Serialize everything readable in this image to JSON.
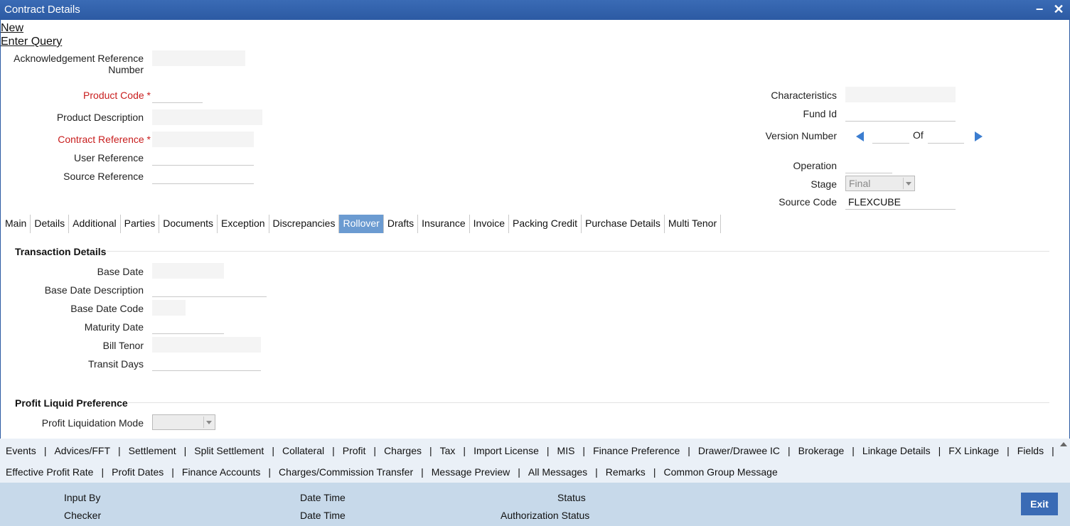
{
  "window": {
    "title": "Contract Details"
  },
  "actions": {
    "new": "New",
    "enter_query": "Enter Query"
  },
  "header": {
    "ack_ref_label_1": "Acknowledgement Reference",
    "ack_ref_label_2": "Number",
    "product_code_label": "Product Code",
    "required_mark": "*",
    "product_description_label": "Product Description",
    "contract_reference_label": "Contract Reference",
    "user_reference_label": "User Reference",
    "source_reference_label": "Source Reference",
    "characteristics_label": "Characteristics",
    "fund_id_label": "Fund Id",
    "version_number_label": "Version Number",
    "version_of": "Of",
    "operation_label": "Operation",
    "stage_label": "Stage",
    "stage_value": "Final",
    "source_code_label": "Source Code",
    "source_code_value": "FLEXCUBE"
  },
  "tabs": [
    {
      "label": "Main"
    },
    {
      "label": "Details"
    },
    {
      "label": "Additional"
    },
    {
      "label": "Parties"
    },
    {
      "label": "Documents"
    },
    {
      "label": "Exception"
    },
    {
      "label": "Discrepancies"
    },
    {
      "label": "Rollover"
    },
    {
      "label": "Drafts"
    },
    {
      "label": "Insurance"
    },
    {
      "label": "Invoice"
    },
    {
      "label": "Packing Credit"
    },
    {
      "label": "Purchase Details"
    },
    {
      "label": "Multi Tenor"
    }
  ],
  "active_tab": "Rollover",
  "transaction": {
    "title": "Transaction Details",
    "base_date": "Base Date",
    "base_date_description": "Base Date Description",
    "base_date_code": "Base Date Code",
    "maturity_date": "Maturity Date",
    "bill_tenor": "Bill Tenor",
    "transit_days": "Transit Days"
  },
  "profit": {
    "title": "Profit Liquid Preference",
    "mode_label": "Profit Liquidation Mode"
  },
  "bottom_links_row1": [
    "Events",
    "Advices/FFT",
    "Settlement",
    "Split Settlement",
    "Collateral",
    "Profit",
    "Charges",
    "Tax",
    "Import License",
    "MIS",
    "Finance Preference",
    "Drawer/Drawee IC",
    "Brokerage",
    "Linkage Details",
    "FX Linkage",
    "Fields"
  ],
  "bottom_links_row2": [
    "Effective Profit Rate",
    "Profit Dates",
    "Finance Accounts",
    "Charges/Commission Transfer",
    "Message Preview",
    "All Messages",
    "Remarks",
    "Common Group Message"
  ],
  "status": {
    "input_by": "Input By",
    "checker": "Checker",
    "date_time_1": "Date Time",
    "date_time_2": "Date Time",
    "status": "Status",
    "authorization_status": "Authorization Status",
    "exit": "Exit"
  },
  "colors": {
    "title_bar": "#2c5aa3",
    "active_tab": "#6b9bd1",
    "status_bar": "#c7d9ea",
    "required": "#c81d1d",
    "nav_arrow": "#3b7dd0"
  }
}
